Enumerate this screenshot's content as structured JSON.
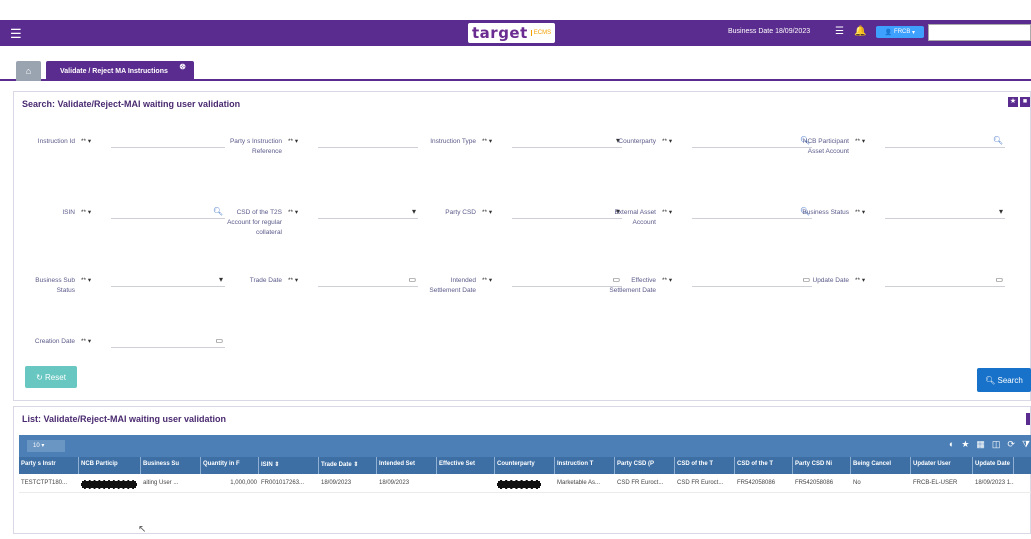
{
  "header": {
    "logo_text": "target",
    "logo_sub": "ECMS",
    "business_date": "Business Date 18/09/2023",
    "user_label": "FRCB",
    "menu_icon": "hamburger-icon",
    "list_icon": "list-icon",
    "bell_icon": "bell-icon"
  },
  "tabs": {
    "home_icon": "home-icon",
    "active_label": "Validate / Reject MA Instructions"
  },
  "search": {
    "title": "Search: Validate/Reject-MAI waiting user validation",
    "operator": "** ▾",
    "fields": [
      {
        "label": "Instruction Id"
      },
      {
        "label": "Party s Instruction Reference"
      },
      {
        "label": "Instruction Type"
      },
      {
        "label": "Counterparty"
      },
      {
        "label": "NCB Participant Asset Account"
      },
      {
        "label": "ISIN"
      },
      {
        "label": "CSD of the T2S Account for regular collateral"
      },
      {
        "label": "Party CSD"
      },
      {
        "label": "External Asset Account"
      },
      {
        "label": "Business Status"
      },
      {
        "label": "Business Sub Status"
      },
      {
        "label": "Trade Date"
      },
      {
        "label": "Intended Settlement Date"
      },
      {
        "label": "Effective Settlement Date"
      },
      {
        "label": "Update Date"
      },
      {
        "label": "Creation Date"
      }
    ],
    "reset_label": "Reset",
    "search_label": "Search"
  },
  "list": {
    "title": "List: Validate/Reject-MAI waiting user validation",
    "page_size": "10",
    "columns": [
      "Party s Instr",
      "NCB Particip",
      "Business Su",
      "Quantity in F",
      "ISIN ⇕",
      "Trade Date ⇕",
      "Intended Set",
      "Effective Set",
      "Counterparty",
      "Instruction T",
      "Party CSD (P",
      "CSD of the T",
      "CSD of the T",
      "Party CSD Ni",
      "Being Cancel",
      "Updater User",
      "Update Date"
    ],
    "rows": [
      [
        "TESTCTPT180...",
        "",
        "aiting User ...",
        "1,000,000",
        "FR001017263...",
        "18/09/2023",
        "18/09/2023",
        "",
        "",
        "Marketable As...",
        "CSD FR Euroct...",
        "CSD FR Euroct...",
        "FR542058086",
        "FR542058086",
        "No",
        "FRCB-EL-USER",
        "18/09/2023 1..."
      ]
    ]
  }
}
